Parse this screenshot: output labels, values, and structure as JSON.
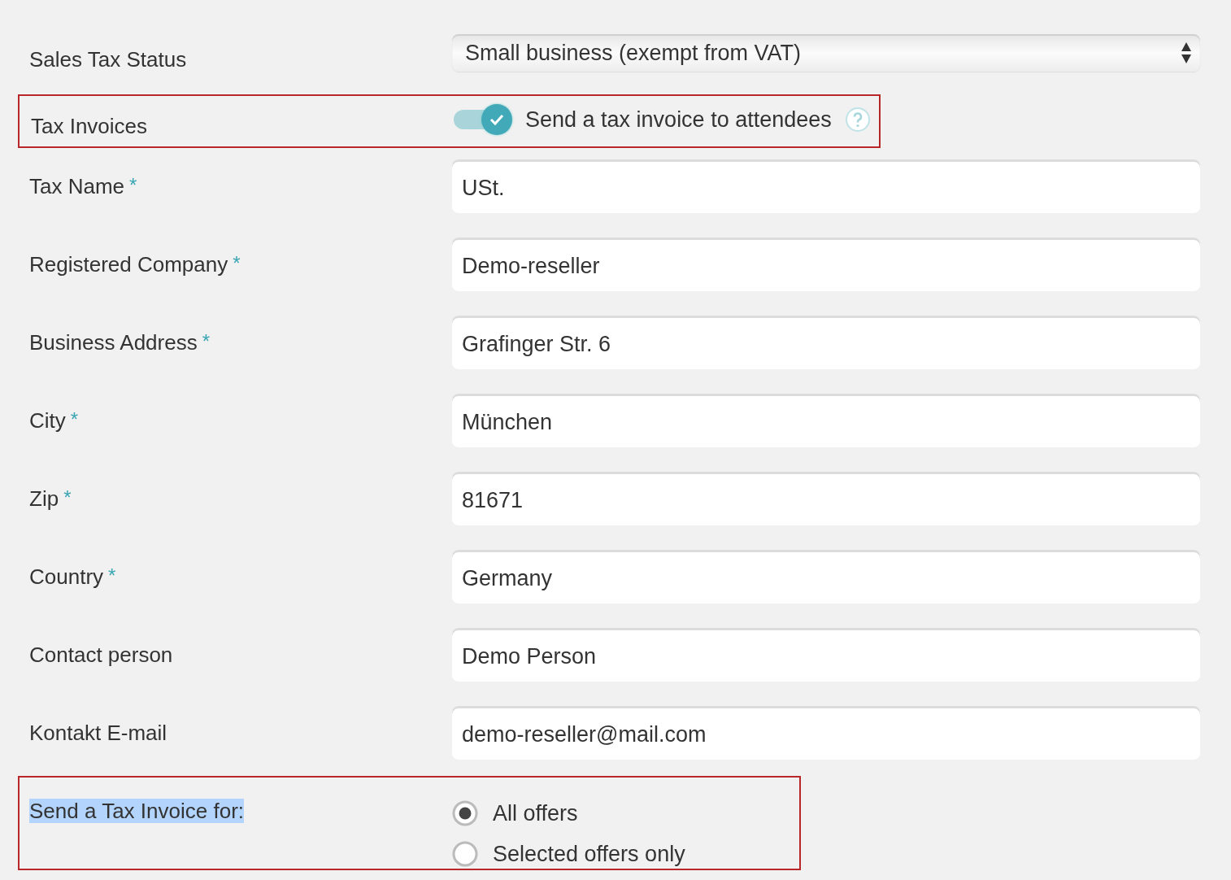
{
  "sales_tax_status": {
    "label": "Sales Tax Status",
    "value": "Small business (exempt from VAT)"
  },
  "tax_invoices": {
    "label": "Tax Invoices",
    "highlighted": true,
    "toggle": {
      "on": true,
      "label": "Send a tax invoice to attendees"
    }
  },
  "fields": [
    {
      "label": "Tax Name",
      "required_mark": "*",
      "value": "USt."
    },
    {
      "label": "Registered Company",
      "required_mark": "*",
      "value": "Demo-reseller"
    },
    {
      "label": "Business Address",
      "required_mark": "*",
      "value": "Grafinger Str. 6"
    },
    {
      "label": "City",
      "required_mark": "*",
      "value": "München"
    },
    {
      "label": "Zip",
      "required_mark": "*",
      "value": "81671"
    },
    {
      "label": "Country",
      "required_mark": "*",
      "value": "Germany"
    },
    {
      "label": "Contact person",
      "value": "Demo Person"
    },
    {
      "label": "Kontakt E-mail",
      "value": "demo-reseller@mail.com"
    }
  ],
  "send_tax_invoice_for": {
    "label": "Send a Tax Invoice for:",
    "highlighted": true,
    "label_text_selected": true,
    "options": [
      {
        "label": "All offers",
        "selected": true
      },
      {
        "label": "Selected offers only",
        "selected": false
      }
    ]
  }
}
